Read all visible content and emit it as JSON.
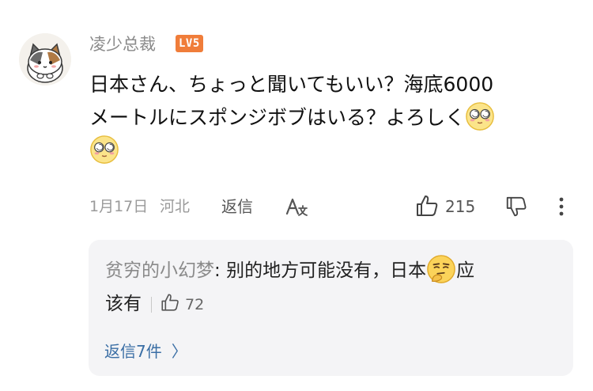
{
  "comment": {
    "author": "凌少总裁",
    "level": "LV5",
    "text_line1": "日本さん、ちょっと聞いてもいい？海底6000",
    "text_line2": "メートルにスポンジボブはいる？よろしく",
    "date": "1月17日",
    "region": "河北",
    "reply_label": "返信",
    "like_count": "215"
  },
  "reply": {
    "author": "贫穷的小幻梦",
    "text_part1": "别的地方可能没有，日本",
    "text_part2": "应",
    "text_part3": "该有",
    "like_count": "72"
  },
  "view_replies_label": "返信7件",
  "view_replies_chevron": "〉",
  "icons": {
    "avatar": "cat-avatar",
    "emoji_comment": "dizzy-eyes-emoji",
    "emoji_reply": "thinking-emoji",
    "translate": "translate-icon",
    "like": "thumbs-up-icon",
    "dislike": "thumbs-down-icon",
    "more": "more-vertical-icon"
  },
  "colors": {
    "level_badge": "#f07d3a",
    "link_blue": "#3a6ea5",
    "reply_bg": "#f4f4f6",
    "muted_text": "#8a8a8a"
  }
}
